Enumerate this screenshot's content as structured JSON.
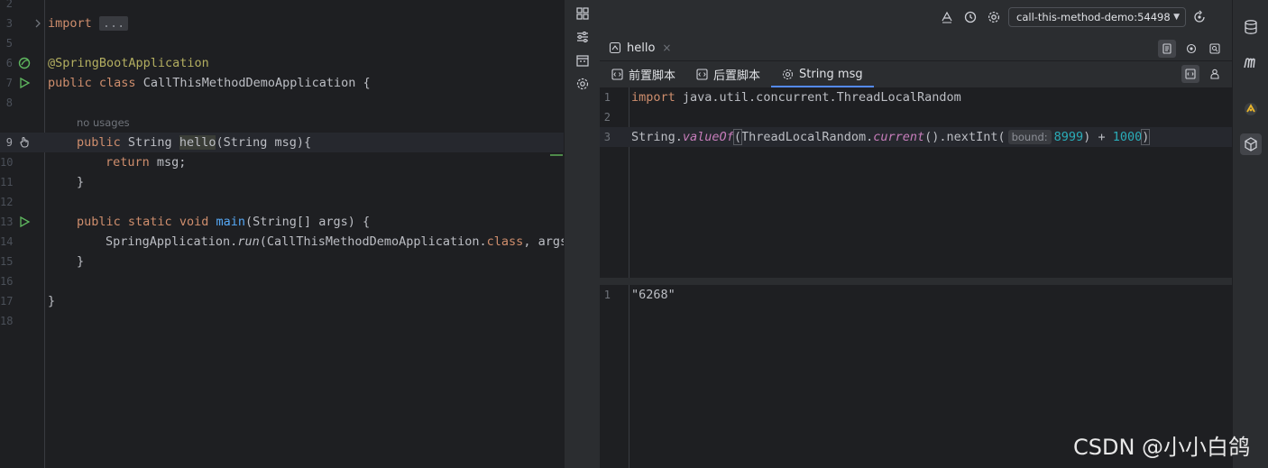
{
  "left_editor": {
    "lines": [
      {
        "num": "2",
        "text": ""
      },
      {
        "num": "3",
        "text": ""
      },
      {
        "num": "5"
      },
      {
        "num": "6"
      },
      {
        "num": "7"
      },
      {
        "num": "8"
      },
      {
        "num": "9"
      },
      {
        "num": "10"
      },
      {
        "num": "11"
      },
      {
        "num": "12"
      },
      {
        "num": "13"
      },
      {
        "num": "14"
      },
      {
        "num": "15"
      },
      {
        "num": "16"
      },
      {
        "num": "17"
      },
      {
        "num": "18"
      }
    ],
    "tokens": {
      "import_kw": "import",
      "import_fold": "...",
      "annotation": "@SpringBootApplication",
      "public_kw": "public",
      "class_kw": "class",
      "class_name": " CallThisMethodDemoApplication {",
      "no_usages": "no usages",
      "string_type": " String ",
      "hello_name": "hello",
      "hello_params": "(String msg){",
      "return_kw": "return",
      "return_rest": " msg;",
      "close_brace": "}",
      "static_kw": "static",
      "void_kw": "void",
      "main_name": "main",
      "main_params": "(String[] args) {",
      "spring_app": "SpringApplication.",
      "run_method": "run",
      "run_args_a": "(CallThisMethodDemoApplication.",
      "run_args_b": ", args)"
    }
  },
  "toolbar": {
    "target_select": "call-this-method-demo:54498"
  },
  "file_tab": {
    "label": "hello",
    "close": "×"
  },
  "script_tabs": [
    {
      "label": "前置脚本"
    },
    {
      "label": "后置脚本"
    },
    {
      "label": "String msg"
    }
  ],
  "script_editor": {
    "line1_num": "1",
    "line2_num": "2",
    "line3_num": "3",
    "import_kw": "import",
    "import_path": " java.util.concurrent.ThreadLocalRandom",
    "string_prefix": "String.",
    "value_of": "valueOf",
    "open_paren": "(",
    "tlr": "ThreadLocalRandom.",
    "current": "current",
    "next_int": "().nextInt(",
    "inlay_bound": "bound:",
    "bound_value": "8999",
    "plus": ") + ",
    "add_value": "1000",
    "close_paren": ")"
  },
  "result_editor": {
    "line1_num": "1",
    "value": "\"6268\""
  },
  "watermark": "CSDN @小小白鸽",
  "colors": {
    "bg": "#1e1f22",
    "panel": "#2b2d30",
    "keyword": "#cf8e6d",
    "annotation": "#b3ae60",
    "function": "#56a8f5",
    "number": "#2aacb8",
    "accent": "#548af7"
  }
}
